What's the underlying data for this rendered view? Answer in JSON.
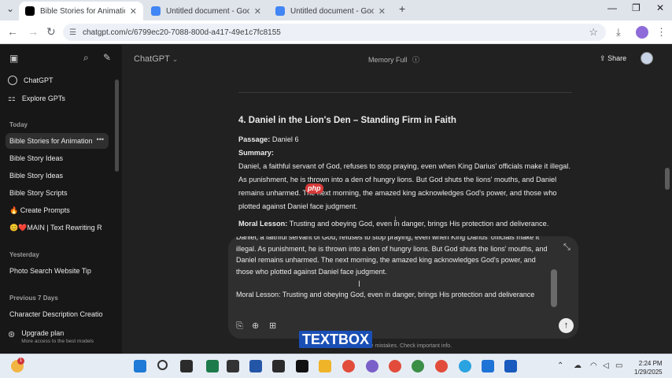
{
  "browser": {
    "tabs": [
      {
        "title": "Bible Stories for Animation",
        "active": true
      },
      {
        "title": "Untitled document - Google Do",
        "active": false
      },
      {
        "title": "Untitled document - Google Do",
        "active": false
      }
    ],
    "new_tab": "+",
    "url": "chatgpt.com/c/6799ec20-7088-800d-a417-49e1c7fc8155"
  },
  "app": {
    "model_selector": "ChatGPT",
    "memory_status": "Memory Full",
    "share_label": "Share"
  },
  "sidebar": {
    "top_items": [
      {
        "label": "ChatGPT"
      },
      {
        "label": "Explore GPTs"
      }
    ],
    "sections": [
      {
        "title": "Today",
        "items": [
          {
            "label": "Bible Stories for Animation",
            "active": true
          },
          {
            "label": "Bible Story Ideas"
          },
          {
            "label": "Bible Story Ideas"
          },
          {
            "label": "Bible Story Scripts"
          },
          {
            "label": "🔥 Create Prompts"
          },
          {
            "label": "😊❤️MAIN | Text Rewriting R"
          }
        ]
      },
      {
        "title": "Yesterday",
        "items": [
          {
            "label": "Photo Search Website Tip"
          }
        ]
      },
      {
        "title": "Previous 7 Days",
        "items": [
          {
            "label": "Character Description Creatio"
          }
        ]
      }
    ],
    "upgrade": {
      "title": "Upgrade plan",
      "subtitle": "More access to the best models"
    }
  },
  "message": {
    "heading": "4. Daniel in the Lion's Den – Standing Firm in Faith",
    "passage_label": "Passage:",
    "passage": "Daniel 6",
    "summary_label": "Summary:",
    "summary": "Daniel, a faithful servant of God, refuses to stop praying, even when King Darius' officials make it illegal. As punishment, he is thrown into a den of hungry lions. But God shuts the lions' mouths, and Daniel remains unharmed. The next morning, the amazed king acknowledges God's power, and those who plotted against Daniel face judgment.",
    "moral_label": "Moral Lesson:",
    "moral": "Trusting and obeying God, even in danger, brings His protection and deliverance."
  },
  "composer": {
    "text": "Daniel, a faithful servant of God, refuses to stop praying, even when King Darius' officials make it illegal. As punishment, he is thrown into a den of hungry lions. But God shuts the lions' mouths, and Daniel remains unharmed. The next morning, the amazed king acknowledges God's power, and those who plotted against Daniel face judgment.\n\nMoral Lesson: Trusting and obeying God, even in danger, brings His protection and deliverance",
    "disclaimer": "GPT can make mistakes. Check important info."
  },
  "overlays": {
    "textbox_logo": "TEXTBOX",
    "php_logo": "php"
  },
  "taskbar": {
    "time": "2:24 PM",
    "date": "1/29/2025",
    "notification_count": "1"
  },
  "colors": {
    "app_bg": "#212121",
    "sidebar_bg": "#171717",
    "composer_bg": "#2f2f2f",
    "taskbar_bg": "#e6ecf4"
  }
}
